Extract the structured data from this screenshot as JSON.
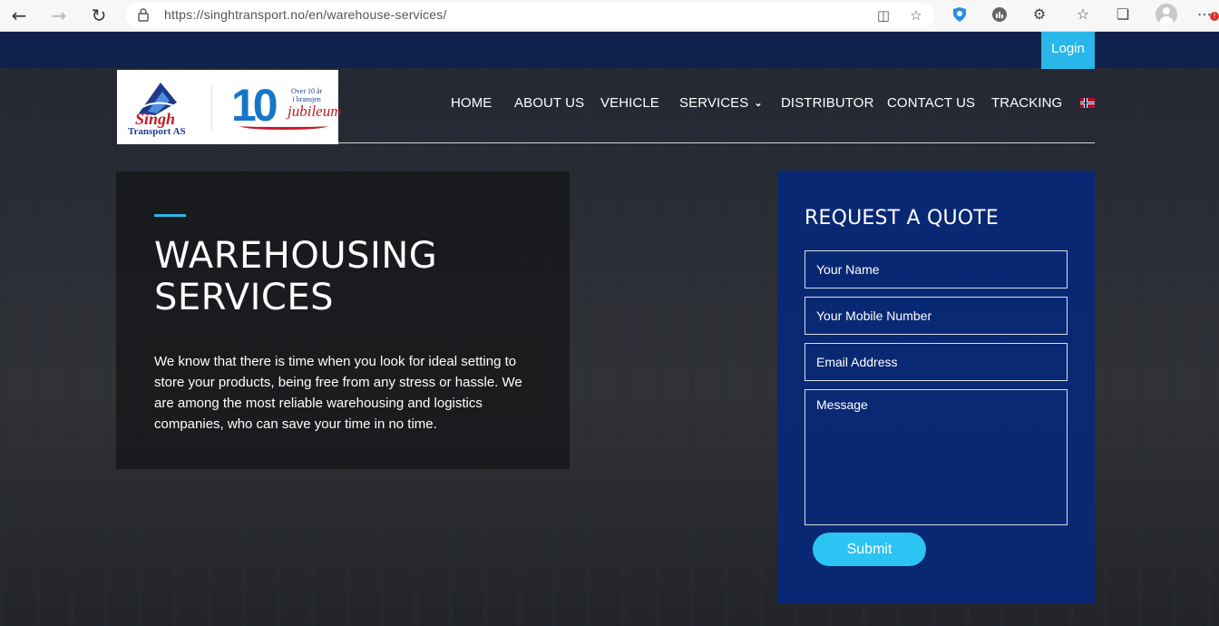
{
  "browser": {
    "url": "https://singhtransport.no/en/warehouse-services/",
    "badge": "!"
  },
  "header": {
    "login_label": "Login",
    "logo": {
      "name": "Singh",
      "subtitle": "Transport AS",
      "anniversary_number": "10",
      "anniversary_tagline_line1": "Over 10 år",
      "anniversary_tagline_line2": "i bransjen",
      "anniversary_word": "jubileum"
    },
    "nav": [
      {
        "label": "HOME"
      },
      {
        "label": "ABOUT US"
      },
      {
        "label": "VEHICLE"
      },
      {
        "label": "SERVICES"
      },
      {
        "label": "DISTRIBUTOR"
      },
      {
        "label": "CONTACT US"
      },
      {
        "label": "TRACKING"
      }
    ]
  },
  "hero": {
    "title_line1": "WAREHOUSING",
    "title_line2": "SERVICES",
    "description": "We know that there is time when you look for ideal setting to store your products, being free from any stress or hassle. We are among the most reliable warehousing and logistics companies, who can save your time in no time."
  },
  "quote_form": {
    "title": "REQUEST A QUOTE",
    "name_placeholder": "Your Name",
    "mobile_placeholder": "Your Mobile Number",
    "email_placeholder": "Email Address",
    "message_placeholder": "Message",
    "submit_label": "Submit"
  },
  "colors": {
    "accent": "#29b6e8",
    "form_panel": "#04287d",
    "top_strip": "#0c2150"
  }
}
